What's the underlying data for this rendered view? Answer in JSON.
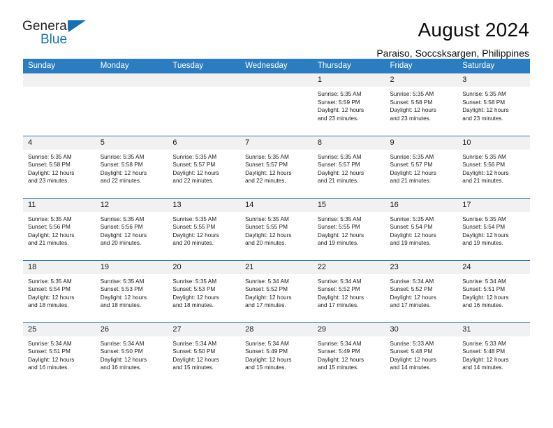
{
  "brand": {
    "name_top": "General",
    "name_bottom": "Blue",
    "triangle_color": "#1271bb"
  },
  "header": {
    "title": "August 2024",
    "location": "Paraiso, Soccsksargen, Philippines"
  },
  "theme": {
    "header_blue": "#2b7cc0",
    "daynum_gray": "#f1f1f1",
    "text": "#1a1a1a"
  },
  "weekday_headers": [
    "Sunday",
    "Monday",
    "Tuesday",
    "Wednesday",
    "Thursday",
    "Friday",
    "Saturday"
  ],
  "weeks": [
    [
      {
        "day": "",
        "lines": []
      },
      {
        "day": "",
        "lines": []
      },
      {
        "day": "",
        "lines": []
      },
      {
        "day": "",
        "lines": []
      },
      {
        "day": "1",
        "lines": [
          "Sunrise: 5:35 AM",
          "Sunset: 5:59 PM",
          "Daylight: 12 hours",
          "and 23 minutes."
        ]
      },
      {
        "day": "2",
        "lines": [
          "Sunrise: 5:35 AM",
          "Sunset: 5:58 PM",
          "Daylight: 12 hours",
          "and 23 minutes."
        ]
      },
      {
        "day": "3",
        "lines": [
          "Sunrise: 5:35 AM",
          "Sunset: 5:58 PM",
          "Daylight: 12 hours",
          "and 23 minutes."
        ]
      }
    ],
    [
      {
        "day": "4",
        "lines": [
          "Sunrise: 5:35 AM",
          "Sunset: 5:58 PM",
          "Daylight: 12 hours",
          "and 23 minutes."
        ]
      },
      {
        "day": "5",
        "lines": [
          "Sunrise: 5:35 AM",
          "Sunset: 5:58 PM",
          "Daylight: 12 hours",
          "and 22 minutes."
        ]
      },
      {
        "day": "6",
        "lines": [
          "Sunrise: 5:35 AM",
          "Sunset: 5:57 PM",
          "Daylight: 12 hours",
          "and 22 minutes."
        ]
      },
      {
        "day": "7",
        "lines": [
          "Sunrise: 5:35 AM",
          "Sunset: 5:57 PM",
          "Daylight: 12 hours",
          "and 22 minutes."
        ]
      },
      {
        "day": "8",
        "lines": [
          "Sunrise: 5:35 AM",
          "Sunset: 5:57 PM",
          "Daylight: 12 hours",
          "and 21 minutes."
        ]
      },
      {
        "day": "9",
        "lines": [
          "Sunrise: 5:35 AM",
          "Sunset: 5:57 PM",
          "Daylight: 12 hours",
          "and 21 minutes."
        ]
      },
      {
        "day": "10",
        "lines": [
          "Sunrise: 5:35 AM",
          "Sunset: 5:56 PM",
          "Daylight: 12 hours",
          "and 21 minutes."
        ]
      }
    ],
    [
      {
        "day": "11",
        "lines": [
          "Sunrise: 5:35 AM",
          "Sunset: 5:56 PM",
          "Daylight: 12 hours",
          "and 21 minutes."
        ]
      },
      {
        "day": "12",
        "lines": [
          "Sunrise: 5:35 AM",
          "Sunset: 5:56 PM",
          "Daylight: 12 hours",
          "and 20 minutes."
        ]
      },
      {
        "day": "13",
        "lines": [
          "Sunrise: 5:35 AM",
          "Sunset: 5:55 PM",
          "Daylight: 12 hours",
          "and 20 minutes."
        ]
      },
      {
        "day": "14",
        "lines": [
          "Sunrise: 5:35 AM",
          "Sunset: 5:55 PM",
          "Daylight: 12 hours",
          "and 20 minutes."
        ]
      },
      {
        "day": "15",
        "lines": [
          "Sunrise: 5:35 AM",
          "Sunset: 5:55 PM",
          "Daylight: 12 hours",
          "and 19 minutes."
        ]
      },
      {
        "day": "16",
        "lines": [
          "Sunrise: 5:35 AM",
          "Sunset: 5:54 PM",
          "Daylight: 12 hours",
          "and 19 minutes."
        ]
      },
      {
        "day": "17",
        "lines": [
          "Sunrise: 5:35 AM",
          "Sunset: 5:54 PM",
          "Daylight: 12 hours",
          "and 19 minutes."
        ]
      }
    ],
    [
      {
        "day": "18",
        "lines": [
          "Sunrise: 5:35 AM",
          "Sunset: 5:54 PM",
          "Daylight: 12 hours",
          "and 18 minutes."
        ]
      },
      {
        "day": "19",
        "lines": [
          "Sunrise: 5:35 AM",
          "Sunset: 5:53 PM",
          "Daylight: 12 hours",
          "and 18 minutes."
        ]
      },
      {
        "day": "20",
        "lines": [
          "Sunrise: 5:35 AM",
          "Sunset: 5:53 PM",
          "Daylight: 12 hours",
          "and 18 minutes."
        ]
      },
      {
        "day": "21",
        "lines": [
          "Sunrise: 5:34 AM",
          "Sunset: 5:52 PM",
          "Daylight: 12 hours",
          "and 17 minutes."
        ]
      },
      {
        "day": "22",
        "lines": [
          "Sunrise: 5:34 AM",
          "Sunset: 5:52 PM",
          "Daylight: 12 hours",
          "and 17 minutes."
        ]
      },
      {
        "day": "23",
        "lines": [
          "Sunrise: 5:34 AM",
          "Sunset: 5:52 PM",
          "Daylight: 12 hours",
          "and 17 minutes."
        ]
      },
      {
        "day": "24",
        "lines": [
          "Sunrise: 5:34 AM",
          "Sunset: 5:51 PM",
          "Daylight: 12 hours",
          "and 16 minutes."
        ]
      }
    ],
    [
      {
        "day": "25",
        "lines": [
          "Sunrise: 5:34 AM",
          "Sunset: 5:51 PM",
          "Daylight: 12 hours",
          "and 16 minutes."
        ]
      },
      {
        "day": "26",
        "lines": [
          "Sunrise: 5:34 AM",
          "Sunset: 5:50 PM",
          "Daylight: 12 hours",
          "and 16 minutes."
        ]
      },
      {
        "day": "27",
        "lines": [
          "Sunrise: 5:34 AM",
          "Sunset: 5:50 PM",
          "Daylight: 12 hours",
          "and 15 minutes."
        ]
      },
      {
        "day": "28",
        "lines": [
          "Sunrise: 5:34 AM",
          "Sunset: 5:49 PM",
          "Daylight: 12 hours",
          "and 15 minutes."
        ]
      },
      {
        "day": "29",
        "lines": [
          "Sunrise: 5:34 AM",
          "Sunset: 5:49 PM",
          "Daylight: 12 hours",
          "and 15 minutes."
        ]
      },
      {
        "day": "30",
        "lines": [
          "Sunrise: 5:33 AM",
          "Sunset: 5:48 PM",
          "Daylight: 12 hours",
          "and 14 minutes."
        ]
      },
      {
        "day": "31",
        "lines": [
          "Sunrise: 5:33 AM",
          "Sunset: 5:48 PM",
          "Daylight: 12 hours",
          "and 14 minutes."
        ]
      }
    ]
  ]
}
